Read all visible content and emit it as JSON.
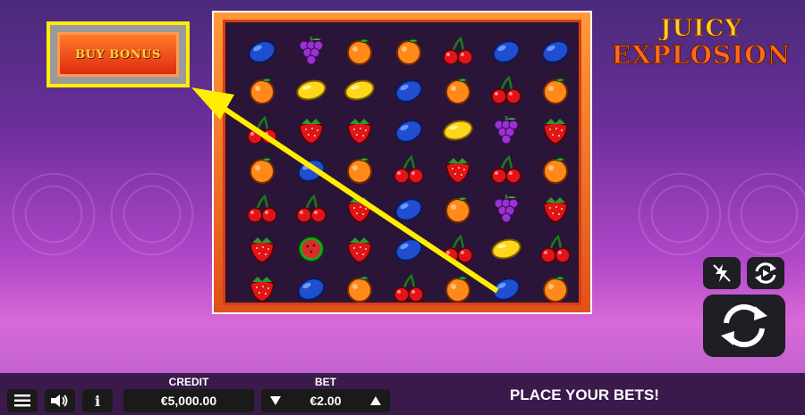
{
  "buy_bonus": {
    "label": "BUY BONUS"
  },
  "logo": {
    "line1": "JUICY",
    "line2": "EXPLOSION"
  },
  "grid": [
    [
      "plum",
      "grapes",
      "orange",
      "orange",
      "cherry",
      "plum",
      "plum"
    ],
    [
      "orange",
      "lemon",
      "lemon",
      "plum",
      "orange",
      "cherry",
      "orange"
    ],
    [
      "cherry",
      "strawberry",
      "strawberry",
      "plum",
      "lemon",
      "grapes",
      "strawberry"
    ],
    [
      "orange",
      "plum",
      "orange",
      "cherry",
      "strawberry",
      "cherry",
      "orange"
    ],
    [
      "cherry",
      "cherry",
      "strawberry",
      "plum",
      "orange",
      "grapes",
      "strawberry"
    ],
    [
      "strawberry",
      "watermelon",
      "strawberry",
      "plum",
      "cherry",
      "lemon",
      "cherry"
    ],
    [
      "strawberry",
      "plum",
      "orange",
      "cherry",
      "orange",
      "plum",
      "orange"
    ]
  ],
  "controls": {
    "turbo_icon": "lightning-icon",
    "autoplay_icon": "autoplay-icon",
    "spin_icon": "spin-icon"
  },
  "bottom_bar": {
    "credit_label": "CREDIT",
    "credit_value": "€5,000.00",
    "bet_label": "BET",
    "bet_value": "€2.00",
    "message": "PLACE YOUR BETS!",
    "menu_icon": "menu-icon",
    "sound_icon": "speaker-icon",
    "info_icon": "info-icon"
  },
  "colors": {
    "highlight": "#ffee00",
    "button_red": "#e02a10",
    "frame_orange": "#ff8a2a"
  }
}
